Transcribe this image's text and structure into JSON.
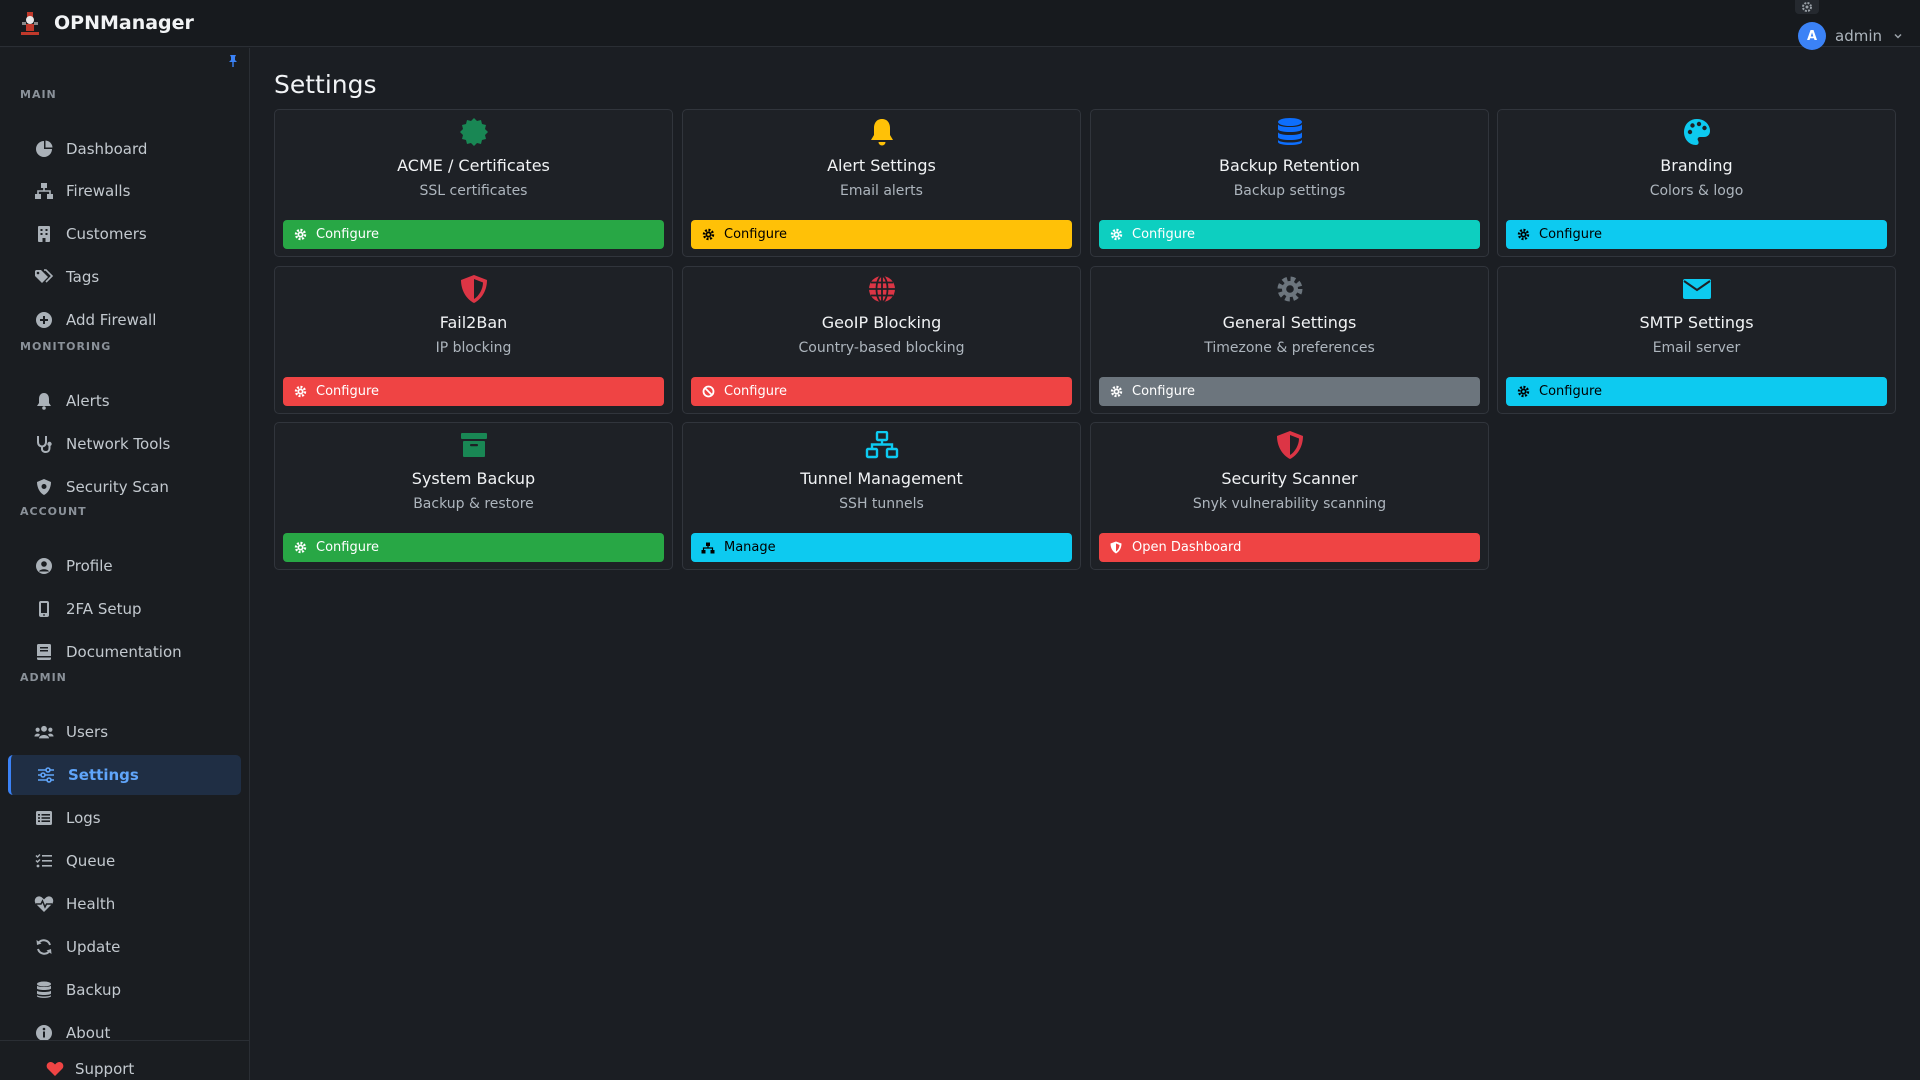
{
  "app": {
    "name": "OPNManager"
  },
  "user": {
    "initial": "A",
    "name": "admin"
  },
  "page": {
    "title": "Settings"
  },
  "sidebar": {
    "sections": [
      {
        "title": "MAIN",
        "items": [
          {
            "label": "Dashboard",
            "icon": "pie-chart-icon"
          },
          {
            "label": "Firewalls",
            "icon": "network-icon"
          },
          {
            "label": "Customers",
            "icon": "building-icon"
          },
          {
            "label": "Tags",
            "icon": "tags-icon"
          },
          {
            "label": "Add Firewall",
            "icon": "plus-circle-icon"
          }
        ]
      },
      {
        "title": "MONITORING",
        "items": [
          {
            "label": "Alerts",
            "icon": "bell-icon"
          },
          {
            "label": "Network Tools",
            "icon": "stethoscope-icon"
          },
          {
            "label": "Security Scan",
            "icon": "shield-icon"
          }
        ]
      },
      {
        "title": "ACCOUNT",
        "items": [
          {
            "label": "Profile",
            "icon": "user-circle-icon"
          },
          {
            "label": "2FA Setup",
            "icon": "mobile-icon"
          },
          {
            "label": "Documentation",
            "icon": "book-icon"
          }
        ]
      },
      {
        "title": "ADMIN",
        "items": [
          {
            "label": "Users",
            "icon": "users-icon"
          },
          {
            "label": "Settings",
            "icon": "sliders-icon",
            "active": true
          },
          {
            "label": "Logs",
            "icon": "list-icon"
          },
          {
            "label": "Queue",
            "icon": "tasks-icon"
          },
          {
            "label": "Health",
            "icon": "heartbeat-icon"
          },
          {
            "label": "Update",
            "icon": "sync-icon"
          },
          {
            "label": "Backup",
            "icon": "database-icon"
          },
          {
            "label": "About",
            "icon": "info-circle-icon"
          }
        ]
      }
    ],
    "support_label": "Support"
  },
  "cards": [
    {
      "title": "ACME / Certificates",
      "subtitle": "SSL certificates",
      "button": "Configure",
      "icon": "certificate-icon",
      "icon_color": "#198754",
      "btn_icon": "gear-icon",
      "btn_bg": "#28a745",
      "btn_fg": "#ffffff"
    },
    {
      "title": "Alert Settings",
      "subtitle": "Email alerts",
      "button": "Configure",
      "icon": "bell-icon",
      "icon_color": "#ffc107",
      "btn_icon": "gear-icon",
      "btn_bg": "#ffc107",
      "btn_fg": "#000000"
    },
    {
      "title": "Backup Retention",
      "subtitle": "Backup settings",
      "button": "Configure",
      "icon": "database-icon",
      "icon_color": "#0d6efd",
      "btn_icon": "gear-icon",
      "btn_bg": "#0dcfc0",
      "btn_fg": "#ffffff"
    },
    {
      "title": "Branding",
      "subtitle": "Colors & logo",
      "button": "Configure",
      "icon": "palette-icon",
      "icon_color": "#0dcaf0",
      "btn_icon": "gear-icon",
      "btn_bg": "#0dcaf0",
      "btn_fg": "#000000"
    },
    {
      "title": "Fail2Ban",
      "subtitle": "IP blocking",
      "button": "Configure",
      "icon": "shield-icon",
      "icon_color": "#dc3545",
      "btn_icon": "gear-icon",
      "btn_bg": "#ef4444",
      "btn_fg": "#ffffff"
    },
    {
      "title": "GeoIP Blocking",
      "subtitle": "Country-based blocking",
      "button": "Configure",
      "icon": "globe-icon",
      "icon_color": "#dc3545",
      "btn_icon": "ban-icon",
      "btn_bg": "#ef4444",
      "btn_fg": "#ffffff"
    },
    {
      "title": "General Settings",
      "subtitle": "Timezone & preferences",
      "button": "Configure",
      "icon": "gear-icon",
      "icon_color": "#6c757d",
      "btn_icon": "gear-icon",
      "btn_bg": "#6c757d",
      "btn_fg": "#ffffff"
    },
    {
      "title": "SMTP Settings",
      "subtitle": "Email server",
      "button": "Configure",
      "icon": "envelope-icon",
      "icon_color": "#0dcaf0",
      "btn_icon": "gear-icon",
      "btn_bg": "#0dcaf0",
      "btn_fg": "#000000"
    },
    {
      "title": "System Backup",
      "subtitle": "Backup & restore",
      "button": "Configure",
      "icon": "archive-icon",
      "icon_color": "#198754",
      "btn_icon": "gear-icon",
      "btn_bg": "#28a745",
      "btn_fg": "#ffffff"
    },
    {
      "title": "Tunnel Management",
      "subtitle": "SSH tunnels",
      "button": "Manage",
      "icon": "network-icon",
      "icon_color": "#0dcaf0",
      "btn_icon": "network-icon",
      "btn_bg": "#0dcaf0",
      "btn_fg": "#000000"
    },
    {
      "title": "Security Scanner",
      "subtitle": "Snyk vulnerability scanning",
      "button": "Open Dashboard",
      "icon": "shield-icon",
      "icon_color": "#dc3545",
      "btn_icon": "shield-icon",
      "btn_bg": "#ef4444",
      "btn_fg": "#ffffff"
    }
  ]
}
